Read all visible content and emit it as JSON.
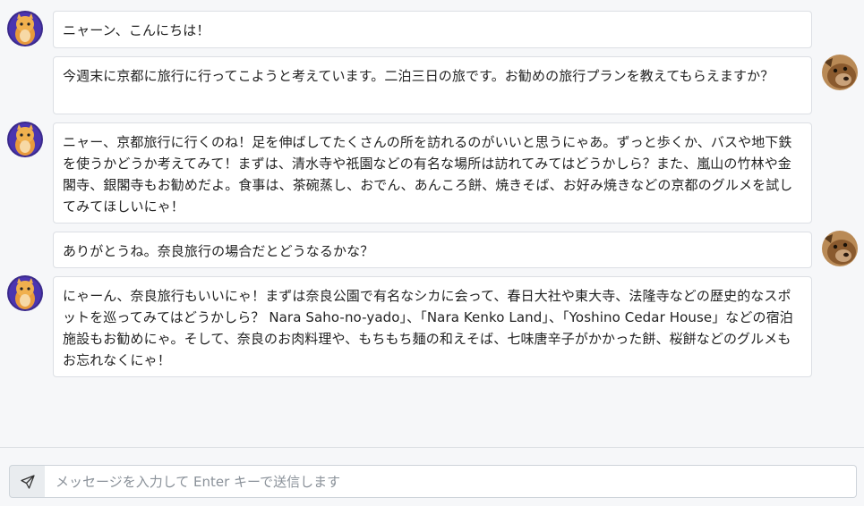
{
  "messages": [
    {
      "role": "bot",
      "text": "ニャーン、こんにちは！"
    },
    {
      "role": "user",
      "text": "今週末に京都に旅行に行ってこようと考えています。二泊三日の旅です。お勧めの旅行プランを教えてもらえますか？"
    },
    {
      "role": "bot",
      "text": "ニャー、京都旅行に行くのね！足を伸ばしてたくさんの所を訪れるのがいいと思うにゃあ。ずっと歩くか、バスや地下鉄を使うかどうか考えてみて！まずは、清水寺や祇園などの有名な場所は訪れてみてはどうかしら？また、嵐山の竹林や金閣寺、銀閣寺もお勧めだよ。食事は、茶碗蒸し、おでん、あんころ餅、焼きそば、お好み焼きなどの京都のグルメを試してみてほしいにゃ！"
    },
    {
      "role": "user",
      "text": "ありがとうね。奈良旅行の場合だとどうなるかな？"
    },
    {
      "role": "bot",
      "text": "にゃーん、奈良旅行もいいにゃ！まずは奈良公園で有名なシカに会って、春日大社や東大寺、法隆寺などの歴史的なスポットを巡ってみてはどうかしら？ Nara Saho-no-yado」、「Nara Kenko Land」、「Yoshino Cedar House」などの宿泊施設もお勧めにゃ。そして、奈良のお肉料理や、もちもち麺の和えそば、七味唐辛子がかかった餅、桜餅などのグルメもお忘れなくにゃ！"
    }
  ],
  "input": {
    "placeholder": "メッセージを入力して Enter キーで送信します",
    "value": ""
  },
  "icons": {
    "send": "send-icon",
    "bot_avatar": "cat-mascot-avatar",
    "user_avatar": "dog-photo-avatar"
  },
  "colors": {
    "background": "#f6f7f9",
    "bubble": "#ffffff",
    "border": "#dcdfe4"
  }
}
